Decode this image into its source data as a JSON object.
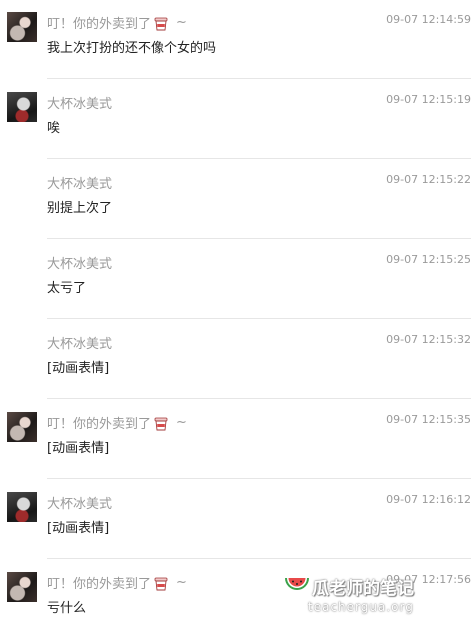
{
  "messages": [
    {
      "sender": "叮！你的外卖到了",
      "suffix": "~",
      "has_cup": true,
      "time": "09-07 12:14:59",
      "text": "我上次打扮的还不像个女的吗",
      "avatar": "a1"
    },
    {
      "sender": "大杯冰美式",
      "suffix": "",
      "has_cup": false,
      "time": "09-07 12:15:19",
      "text": "唉",
      "avatar": "a2"
    },
    {
      "sender": "大杯冰美式",
      "suffix": "",
      "has_cup": false,
      "time": "09-07 12:15:22",
      "text": "别提上次了",
      "avatar": ""
    },
    {
      "sender": "大杯冰美式",
      "suffix": "",
      "has_cup": false,
      "time": "09-07 12:15:25",
      "text": "太亏了",
      "avatar": ""
    },
    {
      "sender": "大杯冰美式",
      "suffix": "",
      "has_cup": false,
      "time": "09-07 12:15:32",
      "text": "[动画表情]",
      "avatar": ""
    },
    {
      "sender": "叮！你的外卖到了",
      "suffix": "~",
      "has_cup": true,
      "time": "09-07 12:15:35",
      "text": "[动画表情]",
      "avatar": "a1"
    },
    {
      "sender": "大杯冰美式",
      "suffix": "",
      "has_cup": false,
      "time": "09-07 12:16:12",
      "text": "[动画表情]",
      "avatar": "a2"
    },
    {
      "sender": "叮！你的外卖到了",
      "suffix": "~",
      "has_cup": true,
      "time": "09-07 12:17:56",
      "text": "亏什么",
      "avatar": "a1"
    }
  ],
  "watermark": {
    "title": "瓜老师的笔记",
    "url": "teachergua.org",
    "icon": "watermelon-icon"
  },
  "colors": {
    "name": "#999999",
    "time": "#9a9a9a",
    "text": "#222222",
    "divider": "#e6e6e6"
  }
}
